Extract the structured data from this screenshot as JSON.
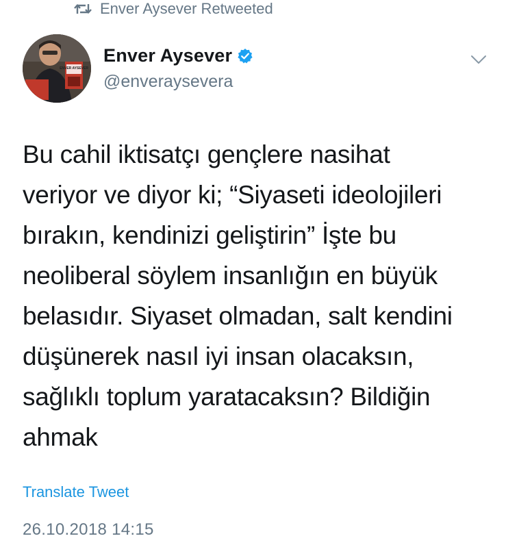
{
  "retweet_context": {
    "icon": "retweet-icon",
    "text": "Enver Aysever Retweeted"
  },
  "author": {
    "display_name": "Enver Aysever",
    "verified": true,
    "verified_icon": "verified-badge-icon",
    "handle": "@enveraysevera",
    "avatar_book_text": "ENVER AYSEVER"
  },
  "menu": {
    "icon": "chevron-down-icon"
  },
  "tweet": {
    "lines": [
      "Bu cahil iktisatçı gençlere nasihat",
      "veriyor ve diyor ki; “Siyaseti ideolojileri",
      "bırakın, kendinizi geliştirin” İşte bu",
      "neoliberal söylem insanlığın en büyük",
      "belasıdır. Siyaset olmadan, salt kendini",
      "düşünerek nasıl iyi insan olacaksın,",
      "sağlıklı toplum yaratacaksın? Bildiğin",
      "ahmak"
    ],
    "translate_label": "Translate Tweet",
    "timestamp": "26.10.2018 14:15"
  },
  "colors": {
    "text_primary": "#14171a",
    "text_secondary": "#657786",
    "link": "#1b95e0",
    "verified": "#1da1f2"
  }
}
